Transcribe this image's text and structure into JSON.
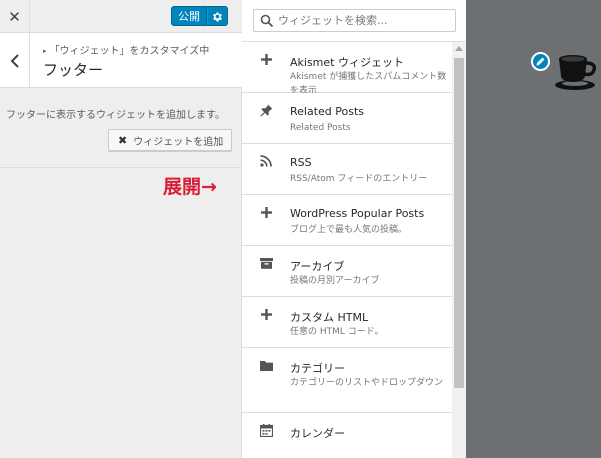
{
  "topbar": {
    "close_icon": "close-icon",
    "publish_label": "公開",
    "publish_settings_icon": "gear-icon"
  },
  "section": {
    "breadcrumb": "「ウィジェット」をカスタマイズ中",
    "title": "フッター",
    "back_icon": "chevron-left-icon"
  },
  "sidebar": {
    "description": "フッターに表示するウィジェットを追加します。",
    "add_widget_label": "ウィジェットを追加"
  },
  "annotation": {
    "text": "展開→",
    "color": "#d9203a"
  },
  "search": {
    "placeholder": "ウィジェットを検索..."
  },
  "widgets": [
    {
      "icon": "plus-icon",
      "title": "Akismet ウィジェット",
      "description": "Akismet が捕獲したスパムコメント数を表示"
    },
    {
      "icon": "pin-icon",
      "title": "Related Posts",
      "description": "Related Posts"
    },
    {
      "icon": "rss-icon",
      "title": "RSS",
      "description": "RSS/Atom フィードのエントリー"
    },
    {
      "icon": "plus-icon",
      "title": "WordPress Popular Posts",
      "description": "ブログ上で最も人気の投稿。"
    },
    {
      "icon": "archive-icon",
      "title": "アーカイブ",
      "description": "投稿の月別アーカイブ"
    },
    {
      "icon": "plus-icon",
      "title": "カスタム HTML",
      "description": "任意の HTML コード。"
    },
    {
      "icon": "folder-icon",
      "title": "カテゴリー",
      "description": "カテゴリーのリストやドロップダウン"
    },
    {
      "icon": "calendar-icon",
      "title": "カレンダー",
      "description": ""
    }
  ],
  "colors": {
    "accent": "#0085ba",
    "panel_bg": "#ffffff",
    "sidebar_bg": "#eeeeee",
    "preview_bg": "#6d7073"
  },
  "preview": {
    "edit_icon": "pencil-icon",
    "logo_icon": "coffee-cup-icon"
  }
}
